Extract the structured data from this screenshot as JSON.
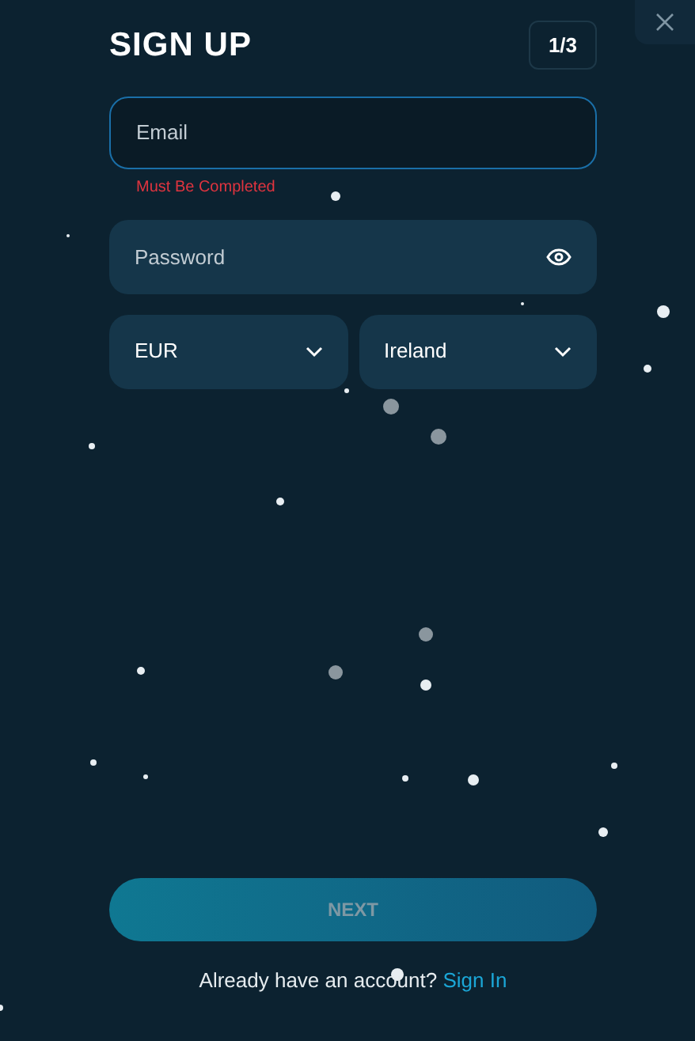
{
  "title": "SIGN UP",
  "step": "1/3",
  "email": {
    "placeholder": "Email",
    "error": "Must Be Completed"
  },
  "password": {
    "placeholder": "Password"
  },
  "selects": [
    {
      "value": "EUR"
    },
    {
      "value": "Ireland"
    }
  ],
  "next_button": {
    "label": "NEXT",
    "disabled": true
  },
  "footer": {
    "text": "Already have an account?",
    "link": "Sign In"
  }
}
